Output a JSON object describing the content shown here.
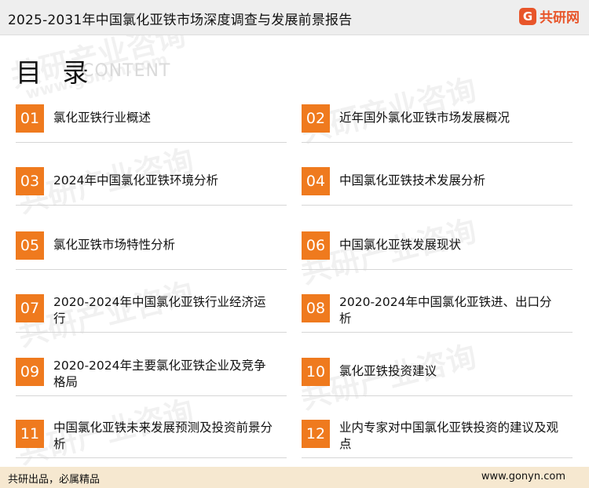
{
  "header": {
    "title": "2025-2031年中国氯化亚铁市场深度调查与发展前景报告",
    "brand": "共研网",
    "brand_mark": "G"
  },
  "toc": {
    "heading": "目 录",
    "heading_en": "CONTENT",
    "items": [
      {
        "num": "01",
        "label": "氯化亚铁行业概述"
      },
      {
        "num": "02",
        "label": "近年国外氯化亚铁市场发展概况"
      },
      {
        "num": "03",
        "label": "2024年中国氯化亚铁环境分析"
      },
      {
        "num": "04",
        "label": "中国氯化亚铁技术发展分析"
      },
      {
        "num": "05",
        "label": "氯化亚铁市场特性分析"
      },
      {
        "num": "06",
        "label": "中国氯化亚铁发展现状"
      },
      {
        "num": "07",
        "label": "2020-2024年中国氯化亚铁行业经济运行"
      },
      {
        "num": "08",
        "label": "2020-2024年中国氯化亚铁进、出口分析"
      },
      {
        "num": "09",
        "label": "2020-2024年主要氯化亚铁企业及竞争格局"
      },
      {
        "num": "10",
        "label": "氯化亚铁投资建议"
      },
      {
        "num": "11",
        "label": "中国氯化亚铁未来发展预测及投资前景分析"
      },
      {
        "num": "12",
        "label": "业内专家对中国氯化亚铁投资的建议及观点"
      }
    ]
  },
  "footer": {
    "slogan": "共研出品，必属精品",
    "url": "www.gonyn.com"
  },
  "watermark": {
    "cn": "共研产业咨询",
    "en": "www.gonyn.com"
  },
  "colors": {
    "accent": "#ef7a1e",
    "brand": "#e8552a",
    "footer_bg": "#f6e8d0",
    "header_bg": "#eeeeee"
  }
}
